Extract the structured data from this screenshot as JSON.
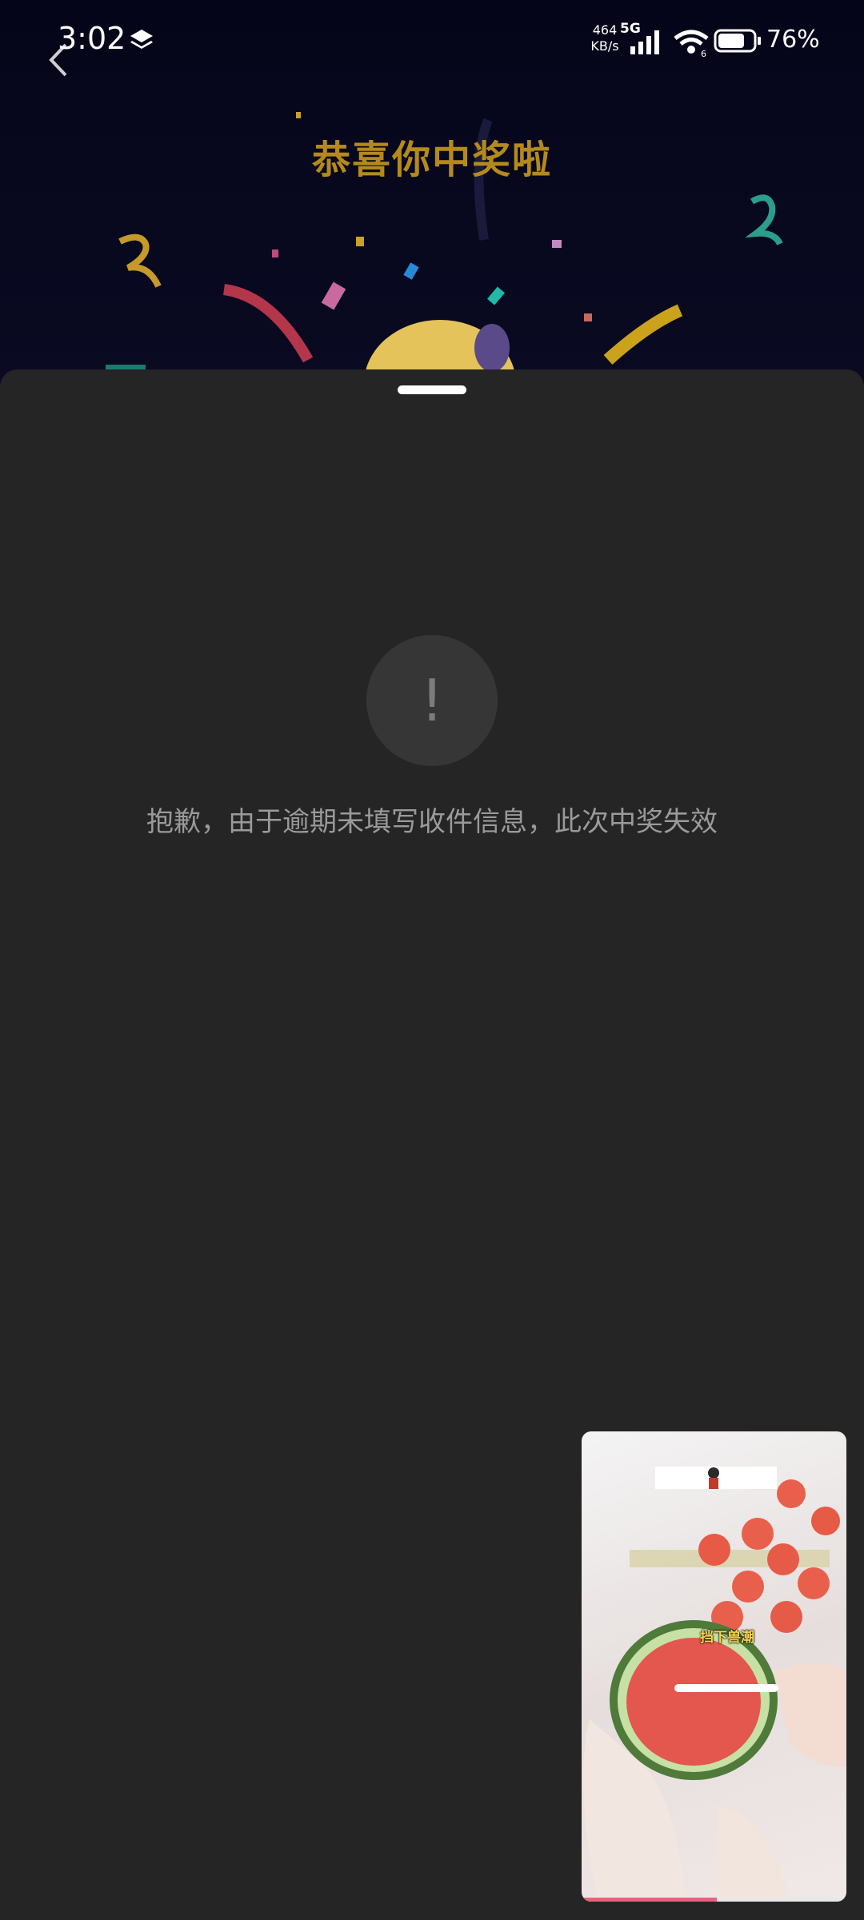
{
  "status_bar": {
    "time": "3:02",
    "net_speed_value": "464",
    "net_speed_unit": "KB/s",
    "network_type": "5G",
    "battery_percent": "76%",
    "battery_level": 0.76
  },
  "background": {
    "title": "恭喜你中奖啦",
    "title_color": "#b58a1c"
  },
  "sheet": {
    "alert_symbol": "!",
    "message": "抱歉，由于逾期未填写收件信息，此次中奖失效"
  },
  "pip_video": {
    "caption": "挡下兽潮",
    "progress": 0.51
  },
  "colors": {
    "sheet_bg": "#252525",
    "accent": "#e8617f"
  }
}
